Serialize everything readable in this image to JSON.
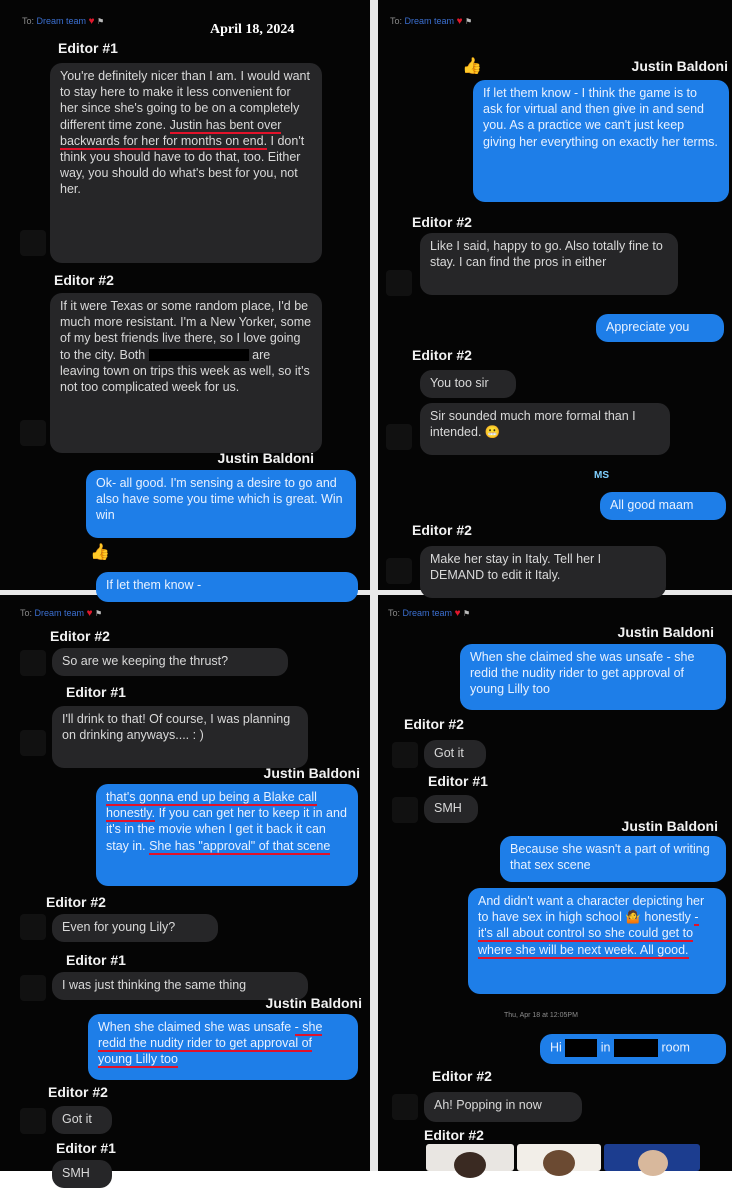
{
  "header": {
    "to": "To:",
    "group": "Dream team",
    "heart": "♥",
    "flag": "⚑"
  },
  "date": "April 18, 2024",
  "names": {
    "ed1": "Editor #1",
    "ed2": "Editor #2",
    "jb": "Justin Baldoni"
  },
  "q1": {
    "m1_pre": "You're definitely nicer than I am. I would want to stay here to make it less convenient for her since she's going to be on a completely different time zone. ",
    "m1_hl": "Justin has bent over backwards for her for months on end.",
    "m1_post": " I don't think you should have to do that, too. Either way, you should do what's best for you, not her.",
    "m2_a": "If it were Texas or some random place, I'd be much more resistant. I'm a New Yorker, some of my best friends live there, so I love going to the city. Both ",
    "m2_b": " are leaving town on trips this week as well, so it's not too complicated week for us.",
    "m3": "Ok- all good. I'm sensing a desire to go and also have some you time which is great. Win win",
    "m4": "If let them know -"
  },
  "q2": {
    "m1": "If let them know - I think the game is to ask for virtual and then give in and send you. As a practice we can't just keep giving her everything on exactly her terms.",
    "m2": "Like I said, happy to go. Also totally fine to stay. I can find the pros in either",
    "m3": "Appreciate you",
    "m4": "You too sir",
    "m5": "Sir sounded much more formal than I intended. 😬",
    "m6": "All good maam",
    "m7": "Make her stay in Italy. Tell her I DEMAND to edit it Italy."
  },
  "q3": {
    "m1": "So are we keeping the thrust?",
    "m2": "I'll drink to that! Of course, I was planning on drinking anyways.... : )",
    "m3_hl1": "that's gonna end up being a Blake call honestly.",
    "m3_mid": " If you can get her to keep it in and it's in the movie when I get it back it can stay in. ",
    "m3_hl2": "She has \"approval\" of that scene",
    "m4": "Even for young Lily?",
    "m5": "I was just thinking the same thing",
    "m6_a": "When she claimed she was unsafe ",
    "m6_hl": "- she redid the nudity rider to get approval of young Lilly too",
    "m7": "Got it",
    "m8": "SMH"
  },
  "q4": {
    "m1": "When she claimed she was unsafe - she redid the nudity rider to get approval of young Lilly too",
    "m2": "Got it",
    "m3": "SMH",
    "m4": "Because she wasn't a part of writing that sex scene",
    "m5_a": "And didn't want a character depicting her to have sex in high school ",
    "m5_b": "🤷 honestly ",
    "m5_hl": "- it's all about control so she could get to where she will be next week. All good.",
    "timestamp": "Thu, Apr 18 at 12:05PM",
    "m6_a": "Hi",
    "m6_b": "in",
    "m6_c": "room",
    "m7": "Ah! Popping in now"
  },
  "reactions": {
    "thumbs": "👍",
    "meme": "MS"
  },
  "colors": {
    "incoming": "#262628",
    "outgoing": "#1e7ee8",
    "underline": "#e2122a",
    "background": "#050505"
  }
}
